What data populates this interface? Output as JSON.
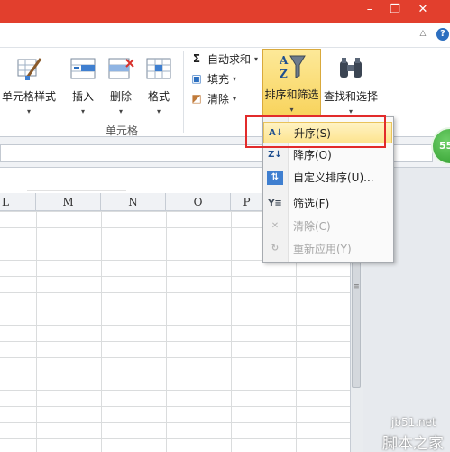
{
  "window": {
    "minimize_glyph": "–",
    "restore_glyph": "❐",
    "close_glyph": "✕",
    "help_glyph": "?",
    "ribbon_collapse_glyph": "△",
    "titlebar_color": "#e23f2d"
  },
  "ribbon": {
    "cell_styles_label": "单元格样式",
    "insert_label": "插入",
    "delete_label": "删除",
    "format_label": "格式",
    "cells_group_label": "单元格",
    "autosum_label": "自动求和",
    "fill_label": "填充",
    "clear_label": "清除",
    "sort_filter_label": "排序和筛选",
    "find_select_label": "查找和选择",
    "dropdown_glyph": "▾",
    "icons": [
      "brush-icon",
      "insert-cells-icon",
      "delete-cells-icon",
      "format-cells-icon",
      "sigma-icon",
      "fill-down-icon",
      "eraser-icon",
      "sort-filter-icon",
      "binoculars-icon"
    ]
  },
  "sort_menu": {
    "items": [
      {
        "label": "升序(S)",
        "icon": "sort-ascending-icon",
        "glyph": "A↓",
        "enabled": true,
        "highlighted": true
      },
      {
        "label": "降序(O)",
        "icon": "sort-descending-icon",
        "glyph": "Z↓",
        "enabled": true,
        "highlighted": false
      },
      {
        "label": "自定义排序(U)...",
        "icon": "custom-sort-icon",
        "glyph": "⇅",
        "enabled": true,
        "highlighted": false
      },
      {
        "label": "筛选(F)",
        "icon": "filter-icon",
        "glyph": "Y≡",
        "enabled": true,
        "highlighted": false
      },
      {
        "label": "清除(C)",
        "icon": "clear-filter-icon",
        "glyph": "✕",
        "enabled": false,
        "highlighted": false
      },
      {
        "label": "重新应用(Y)",
        "icon": "reapply-icon",
        "glyph": "↻",
        "enabled": false,
        "highlighted": false
      }
    ],
    "highlight_color": "#fde48f",
    "annotation_color": "#e22b2b"
  },
  "sheet": {
    "columns": [
      "L",
      "M",
      "N",
      "O",
      "P"
    ],
    "scrollbar_grip": "≡"
  },
  "badge": {
    "text": "55"
  },
  "watermark": {
    "url": "jb51.net",
    "name": "脚本之家"
  }
}
